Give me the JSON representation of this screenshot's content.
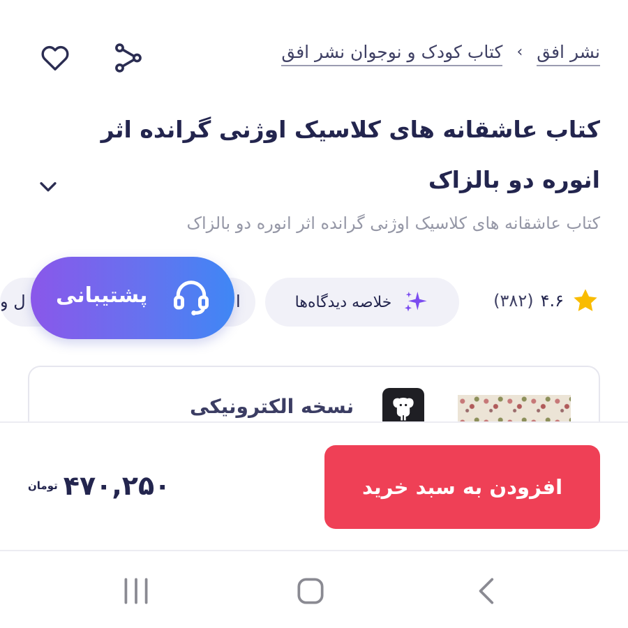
{
  "header": {
    "breadcrumb": [
      "نشر افق",
      "کتاب کودک و نوجوان نشر افق"
    ],
    "breadcrumb_separator": "›",
    "icons": [
      "heart-icon",
      "share-icon"
    ]
  },
  "product": {
    "title": "کتاب عاشقانه های کلاسیک اوژنی گرانده اثر انوره دو بالزاک",
    "subtitle": "کتاب عاشقانه های کلاسیک اوژنی گرانده اثر انوره دو بالزاک",
    "rating": "۴.۶",
    "rating_count": "(۳۸۲)",
    "summary_chip": "خلاصه دیدگاه‌ها",
    "partial_chip_left": "ل و",
    "partial_chip_right": "ا"
  },
  "support": {
    "label": "پشتیبانی"
  },
  "variant": {
    "label": "نسخه الکترونیکی"
  },
  "footer": {
    "add_to_cart": "افزودن به سبد خرید",
    "price": "۴۷۰,۲۵۰",
    "currency": "تومان"
  },
  "colors": {
    "accent": "#ef4056",
    "text": "#23254e",
    "muted": "#9597a6",
    "chip_bg": "#f1f1f8",
    "star": "#f9bc00",
    "sparkle": "#7b4cf0"
  }
}
